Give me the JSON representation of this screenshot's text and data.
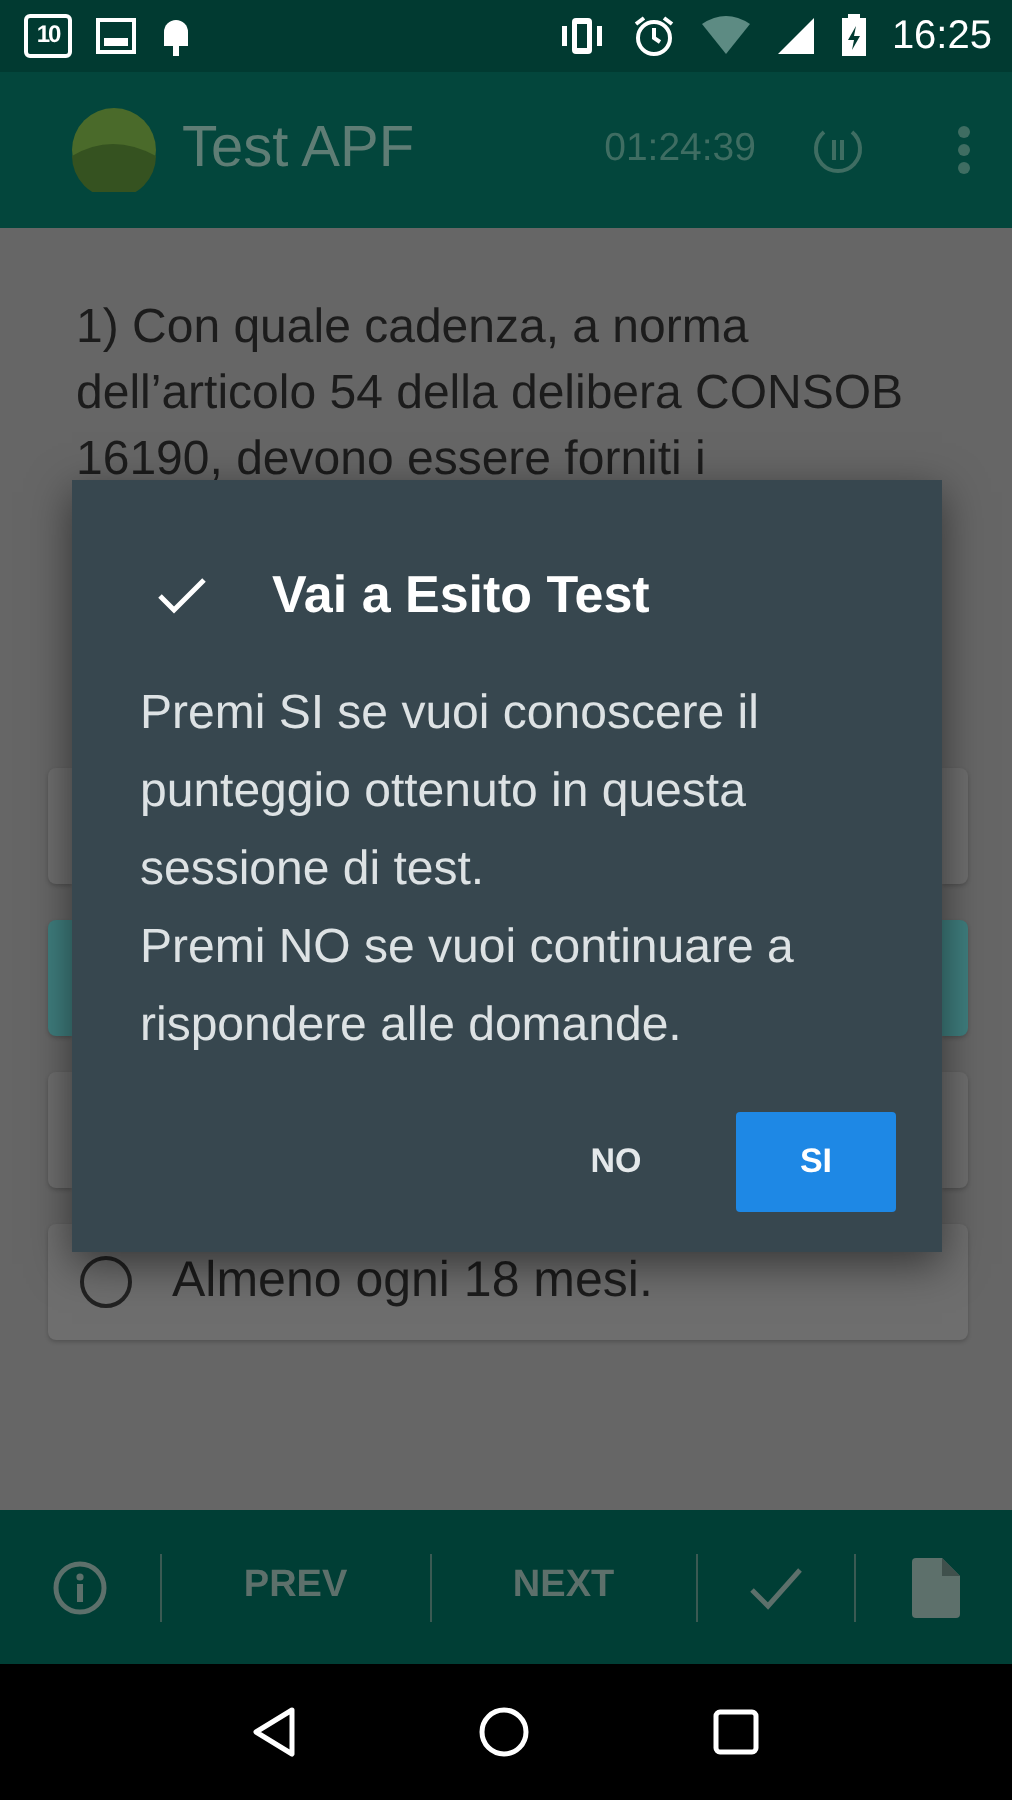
{
  "status_bar": {
    "calendar_day": "10",
    "time": "16:25"
  },
  "app_bar": {
    "title": "Test APF",
    "timer": "01:24:39"
  },
  "question": {
    "text": "1) Con quale cadenza, a norma dell’articolo 54 della delibera CONSOB 16190, devono essere forniti i"
  },
  "answers": [
    {
      "selected": false
    },
    {
      "selected": true
    },
    {
      "selected": false
    },
    {
      "text": "Almeno ogni 18 mesi.",
      "selected": false
    }
  ],
  "dialog": {
    "title": "Vai a Esito Test",
    "message": "Premi SI se vuoi conoscere il punteggio ottenuto in questa sessione di test.\nPremi NO se vuoi continuare a rispondere alle domande.",
    "buttons": [
      {
        "label": "NO",
        "kind": "text"
      },
      {
        "label": "SI",
        "kind": "primary"
      }
    ]
  },
  "bottom_bar": {
    "prev": "PREV",
    "next": "NEXT"
  }
}
